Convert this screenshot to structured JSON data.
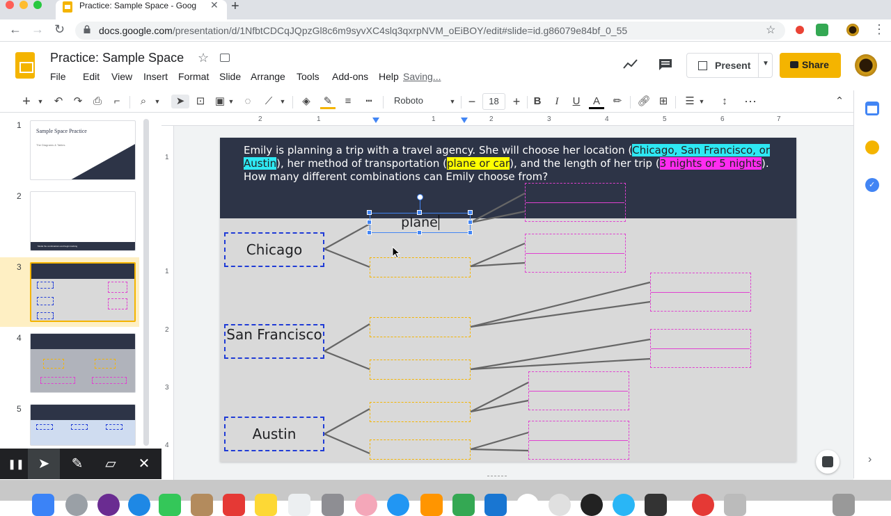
{
  "browser": {
    "tab_title": "Practice: Sample Space - Goog",
    "tab_close": "✕",
    "new_tab": "+",
    "url_host": "docs.google.com",
    "url_path": "/presentation/d/1NfbtCDCqJQpzGl8c6m9syvXC4slq3qxrpNVM_oEiBOY/edit#slide=id.g86079e84bf_0_55"
  },
  "doc": {
    "title": "Practice: Sample Space",
    "menu": [
      "File",
      "Edit",
      "View",
      "Insert",
      "Format",
      "Slide",
      "Arrange",
      "Tools",
      "Add-ons",
      "Help"
    ],
    "saving": "Saving...",
    "present_label": "Present",
    "share_label": "Share"
  },
  "toolbar": {
    "font_name": "Roboto",
    "font_size": "18",
    "bold": "B",
    "italic": "I",
    "underline": "U",
    "text_color": "A",
    "more": "⋯"
  },
  "ruler": {
    "h_labels": [
      "2",
      "1",
      "1",
      "2",
      "3",
      "4",
      "5",
      "6",
      "7"
    ],
    "v_labels": [
      "1",
      "1",
      "2",
      "3",
      "4"
    ]
  },
  "filmstrip": {
    "numbers": [
      "1",
      "2",
      "3",
      "4",
      "5"
    ],
    "thumb1_title": "Sample Space Practice",
    "thumb1_sub": "The Diagrams & Tables",
    "thumb2_text": "Model the combinations and begin tracking"
  },
  "slide": {
    "problem_parts": {
      "p1": "Emily is planning a trip with a travel agency. She will choose her location (",
      "loc": "Chicago, San Francisco, or Austin",
      "p2": "), her method of transportation (",
      "trans": "plane or car",
      "p3": "), and the length of her trip (",
      "len": "3 nights or 5 nights",
      "p4": "). How many different combinations can Emily choose from?"
    },
    "cities": [
      "Chicago",
      "San Francisco",
      "Austin"
    ],
    "editing_text": "plane"
  },
  "colors": {
    "slide_header": "#2d3447",
    "city_box": "#1f3bd6",
    "trans_box": "#f4b400",
    "len_box": "#e040d0",
    "highlight_cyan": "#2ee8f3",
    "highlight_yellow": "#ffff00",
    "highlight_magenta": "#ff2cf0",
    "share": "#f4b400"
  },
  "annotation_toolbar": {
    "pause": "❚❚",
    "close": "✕"
  }
}
